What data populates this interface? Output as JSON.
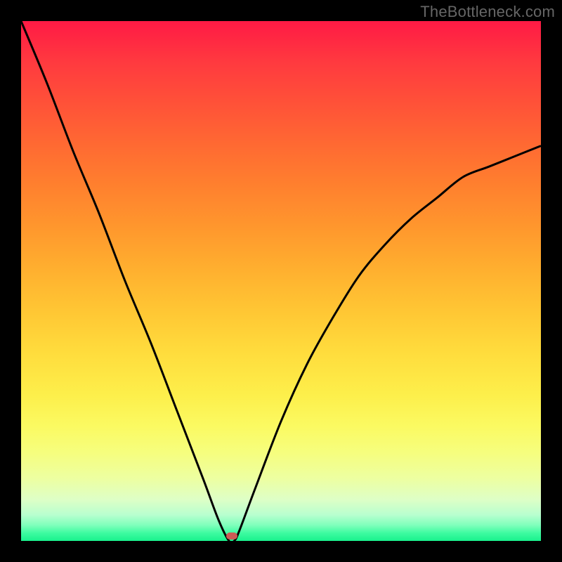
{
  "watermark": "TheBottleneck.com",
  "marker": {
    "x_pct": 40.5,
    "y_pct": 99
  },
  "colors": {
    "frame": "#000000",
    "curve": "#000000",
    "marker": "#cc5a55",
    "gradient_top": "#ff1a45",
    "gradient_bottom": "#19f18d"
  },
  "chart_data": {
    "type": "line",
    "title": "",
    "xlabel": "",
    "ylabel": "",
    "xlim": [
      0,
      100
    ],
    "ylim": [
      0,
      100
    ],
    "annotations": [
      {
        "text": "TheBottleneck.com",
        "position": "top-right"
      }
    ],
    "series": [
      {
        "name": "bottleneck-curve",
        "x": [
          0,
          5,
          10,
          15,
          20,
          25,
          30,
          35,
          38,
          40,
          41,
          42,
          45,
          50,
          55,
          60,
          65,
          70,
          75,
          80,
          85,
          90,
          95,
          100
        ],
        "y": [
          100,
          88,
          75,
          63,
          50,
          38,
          25,
          12,
          4,
          0,
          0,
          2,
          10,
          23,
          34,
          43,
          51,
          57,
          62,
          66,
          70,
          72,
          74,
          76
        ]
      }
    ],
    "markers": [
      {
        "name": "optimal-point",
        "x": 40.5,
        "y": 1
      }
    ],
    "background_gradient": {
      "direction": "vertical",
      "stops": [
        {
          "pos": 0,
          "color": "#ff1a45"
        },
        {
          "pos": 50,
          "color": "#ffb02f"
        },
        {
          "pos": 80,
          "color": "#fbfa62"
        },
        {
          "pos": 100,
          "color": "#19f18d"
        }
      ]
    }
  }
}
